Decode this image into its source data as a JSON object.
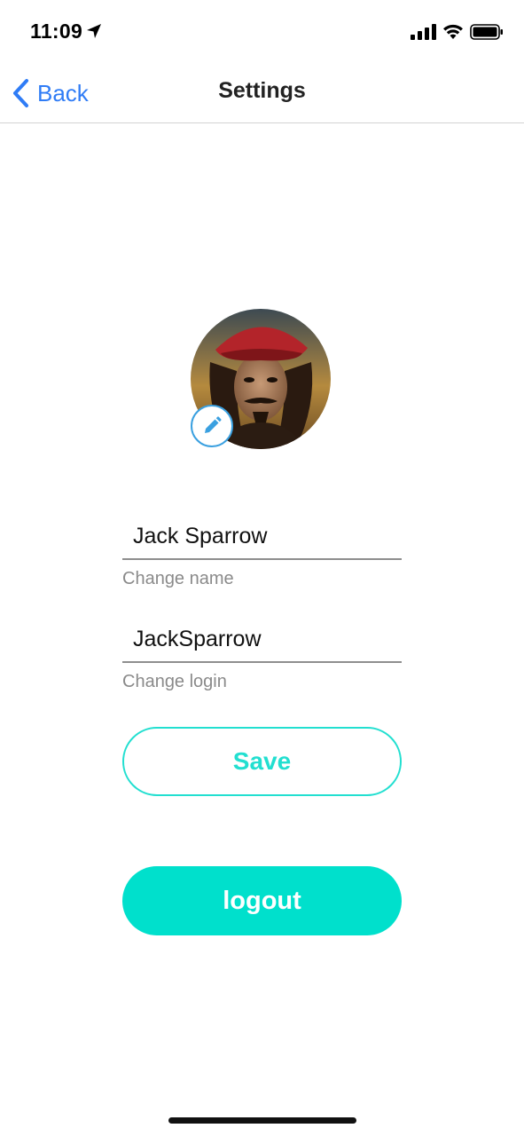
{
  "status_bar": {
    "time": "11:09",
    "icons": [
      "location-arrow-icon",
      "cellular-signal-icon",
      "wifi-icon",
      "battery-icon"
    ]
  },
  "nav": {
    "back_label": "Back",
    "title": "Settings"
  },
  "profile": {
    "avatar_icon": "avatar-photo",
    "edit_icon": "pencil-icon"
  },
  "fields": {
    "name": {
      "value": "Jack Sparrow",
      "caption": "Change name"
    },
    "login": {
      "value": "JackSparrow",
      "caption": "Change login"
    }
  },
  "buttons": {
    "save_label": "Save",
    "logout_label": "logout"
  },
  "colors": {
    "accent_blue": "#2f7cf6",
    "accent_teal": "#00e0cc",
    "edit_ring": "#3aa0e0"
  }
}
